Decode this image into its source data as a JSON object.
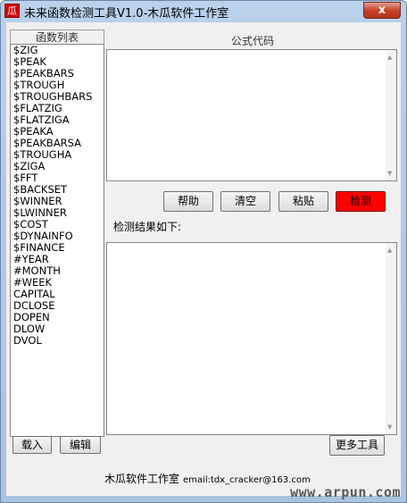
{
  "window": {
    "icon_char": "瓜",
    "title": "未来函数检测工具V1.0-木瓜软件工作室",
    "close_label": "x"
  },
  "function_list": {
    "header": "函数列表",
    "items": [
      "$ZIG",
      "$PEAK",
      "$PEAKBARS",
      "$TROUGH",
      "$TROUGHBARS",
      "$FLATZIG",
      "$FLATZIGA",
      "$PEAKA",
      "$PEAKBARSA",
      "$TROUGHA",
      "$ZIGA",
      "$FFT",
      "$BACKSET",
      "$WINNER",
      "$LWINNER",
      "$COST",
      "$DYNAINFO",
      "$FINANCE",
      "#YEAR",
      "#MONTH",
      "#WEEK",
      "CAPITAL",
      "DCLOSE",
      "DOPEN",
      "DLOW",
      "DVOL"
    ],
    "load_label": "载入",
    "edit_label": "编辑"
  },
  "formula": {
    "label": "公式代码",
    "value": ""
  },
  "actions": {
    "help": "帮助",
    "clear": "清空",
    "paste": "粘贴",
    "detect": "检测"
  },
  "result": {
    "label": "检测结果如下:",
    "value": ""
  },
  "more_tools_label": "更多工具",
  "status": {
    "studio": "木瓜软件工作室",
    "email": "email:tdx_cracker@163.com"
  },
  "watermark": "www.arpun.com",
  "colors": {
    "detect_button": "#ff0000",
    "title_bar": "#b9d1ea"
  }
}
